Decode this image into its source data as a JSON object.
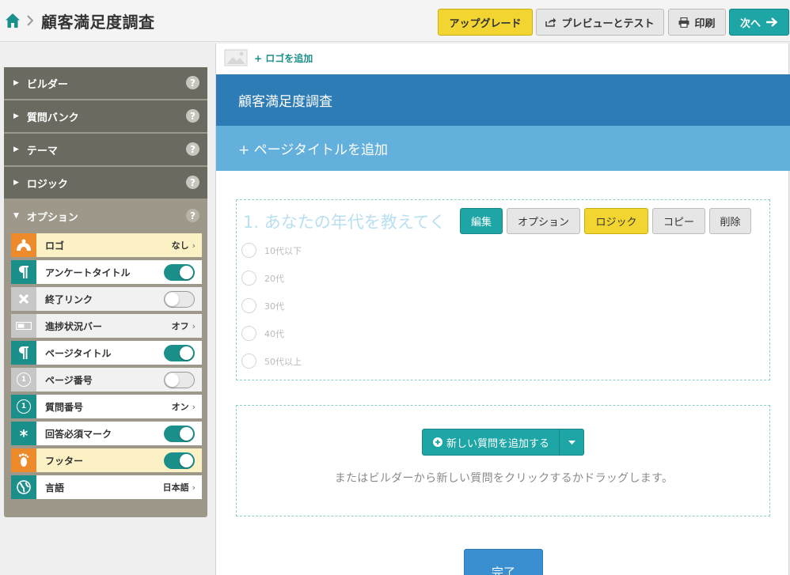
{
  "header": {
    "title": "顧客満足度調査",
    "buttons": {
      "upgrade": "アップグレード",
      "preview": "プレビューとテスト",
      "print": "印刷",
      "next": "次へ"
    }
  },
  "sidebar": {
    "accordion": [
      {
        "label": "ビルダー",
        "open": false
      },
      {
        "label": "質問バンク",
        "open": false
      },
      {
        "label": "テーマ",
        "open": false
      },
      {
        "label": "ロジック",
        "open": false
      },
      {
        "label": "オプション",
        "open": true
      }
    ],
    "help_glyph": "?",
    "options": [
      {
        "label": "ロゴ",
        "type": "value",
        "value": "なし",
        "icon": "logo-icon"
      },
      {
        "label": "アンケートタイトル",
        "type": "toggle",
        "on": true,
        "icon": "paragraph-icon"
      },
      {
        "label": "終了リンク",
        "type": "toggle",
        "on": false,
        "icon": "close-icon"
      },
      {
        "label": "進捗状況バー",
        "type": "value",
        "value": "オフ",
        "icon": "progress-bar-icon"
      },
      {
        "label": "ページタイトル",
        "type": "toggle",
        "on": true,
        "icon": "paragraph-icon"
      },
      {
        "label": "ページ番号",
        "type": "toggle",
        "on": false,
        "icon": "number-icon"
      },
      {
        "label": "質問番号",
        "type": "value",
        "value": "オン",
        "icon": "number-icon"
      },
      {
        "label": "回答必須マーク",
        "type": "toggle",
        "on": true,
        "icon": "asterisk-icon"
      },
      {
        "label": "フッター",
        "type": "toggle",
        "on": true,
        "icon": "footprint-icon"
      },
      {
        "label": "言語",
        "type": "value",
        "value": "日本語",
        "icon": "globe-icon"
      }
    ],
    "number_glyph": "1",
    "asterisk_glyph": "*",
    "chevron_glyph": "›"
  },
  "canvas": {
    "add_logo": "+ ロゴを追加",
    "survey_title": "顧客満足度調査",
    "add_page_title": "+ ページタイトルを追加",
    "question": {
      "title": "1. あなたの年代を教えてく",
      "actions": {
        "edit": "編集",
        "option": "オプション",
        "logic": "ロジック",
        "copy": "コピー",
        "delete": "削除"
      },
      "choices": [
        "10代以下",
        "20代",
        "30代",
        "40代",
        "50代以上"
      ]
    },
    "add_question_button": "新しい質問を追加する",
    "add_hint": "またはビルダーから新しい質問をクリックするかドラッグします。",
    "done_button": "完了"
  },
  "colors": {
    "teal": "#1ea5a5",
    "yellow": "#f2d530",
    "header_blue": "#2d7cb6",
    "page_title_blue": "#63b0dc",
    "sidebar_dark": "#6b6a60",
    "sidebar_light": "#9d9889",
    "orange": "#ed8a2b"
  }
}
